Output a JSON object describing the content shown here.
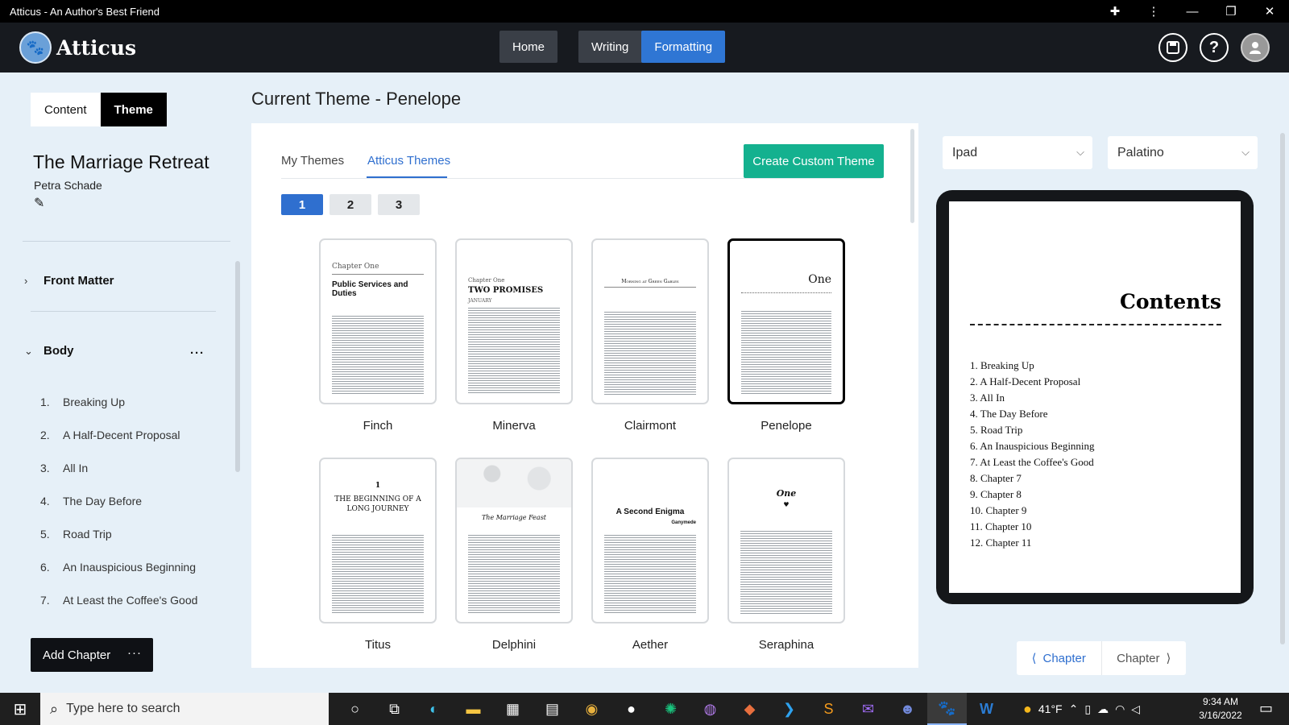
{
  "window": {
    "title": "Atticus - An Author's Best Friend"
  },
  "appbar": {
    "logo_text": "Atticus",
    "nav": {
      "home": "Home",
      "writing": "Writing",
      "formatting": "Formatting"
    }
  },
  "left": {
    "tabs": {
      "content": "Content",
      "theme": "Theme"
    },
    "book_title": "The Marriage Retreat",
    "author": "Petra Schade",
    "front_matter": "Front Matter",
    "body": "Body",
    "chapters": [
      {
        "num": "1.",
        "title": "Breaking Up"
      },
      {
        "num": "2.",
        "title": "A Half-Decent Proposal"
      },
      {
        "num": "3.",
        "title": "All In"
      },
      {
        "num": "4.",
        "title": "The Day Before"
      },
      {
        "num": "5.",
        "title": "Road Trip"
      },
      {
        "num": "6.",
        "title": "An Inauspicious Beginning"
      },
      {
        "num": "7.",
        "title": "At Least the Coffee's Good"
      }
    ],
    "add_chapter": "Add Chapter"
  },
  "main": {
    "current_theme": "Current Theme - Penelope",
    "tabs": {
      "my_themes": "My Themes",
      "atticus_themes": "Atticus Themes"
    },
    "create_button": "Create Custom Theme",
    "pages": [
      "1",
      "2",
      "3"
    ],
    "themes": [
      {
        "name": "Finch",
        "heading_small": "Chapter One",
        "heading": "Public Services and Duties"
      },
      {
        "name": "Minerva",
        "heading_small": "Chapter One",
        "heading": "TWO PROMISES",
        "heading_sub": "JANUARY"
      },
      {
        "name": "Clairmont",
        "heading": "Morning at Green Gables"
      },
      {
        "name": "Penelope",
        "heading": "One"
      },
      {
        "name": "Titus",
        "heading_small": "1",
        "heading": "THE BEGINNING OF A LONG JOURNEY"
      },
      {
        "name": "Delphini",
        "heading": "The Marriage Feast"
      },
      {
        "name": "Aether",
        "heading": "A Second Enigma",
        "heading_sub": "Ganymede"
      },
      {
        "name": "Seraphina",
        "heading": "One"
      }
    ]
  },
  "preview": {
    "device": "Ipad",
    "font": "Palatino",
    "contents_title": "Contents",
    "toc": [
      "1. Breaking Up",
      "2. A Half-Decent Proposal",
      "3. All In",
      "4. The Day Before",
      "5. Road Trip",
      "6. An Inauspicious Beginning",
      "7. At Least the Coffee's Good",
      "8. Chapter 7",
      "9. Chapter 8",
      "10. Chapter 9",
      "11. Chapter 10",
      "12. Chapter 11"
    ],
    "prev_chapter": "Chapter",
    "next_chapter": "Chapter"
  },
  "taskbar": {
    "search_placeholder": "Type here to search",
    "temperature": "41°F",
    "time": "9:34 AM",
    "date": "3/16/2022"
  },
  "colors": {
    "accent_blue": "#2f6fcf",
    "create_green": "#14b18f",
    "app_bar": "#171a1f"
  }
}
